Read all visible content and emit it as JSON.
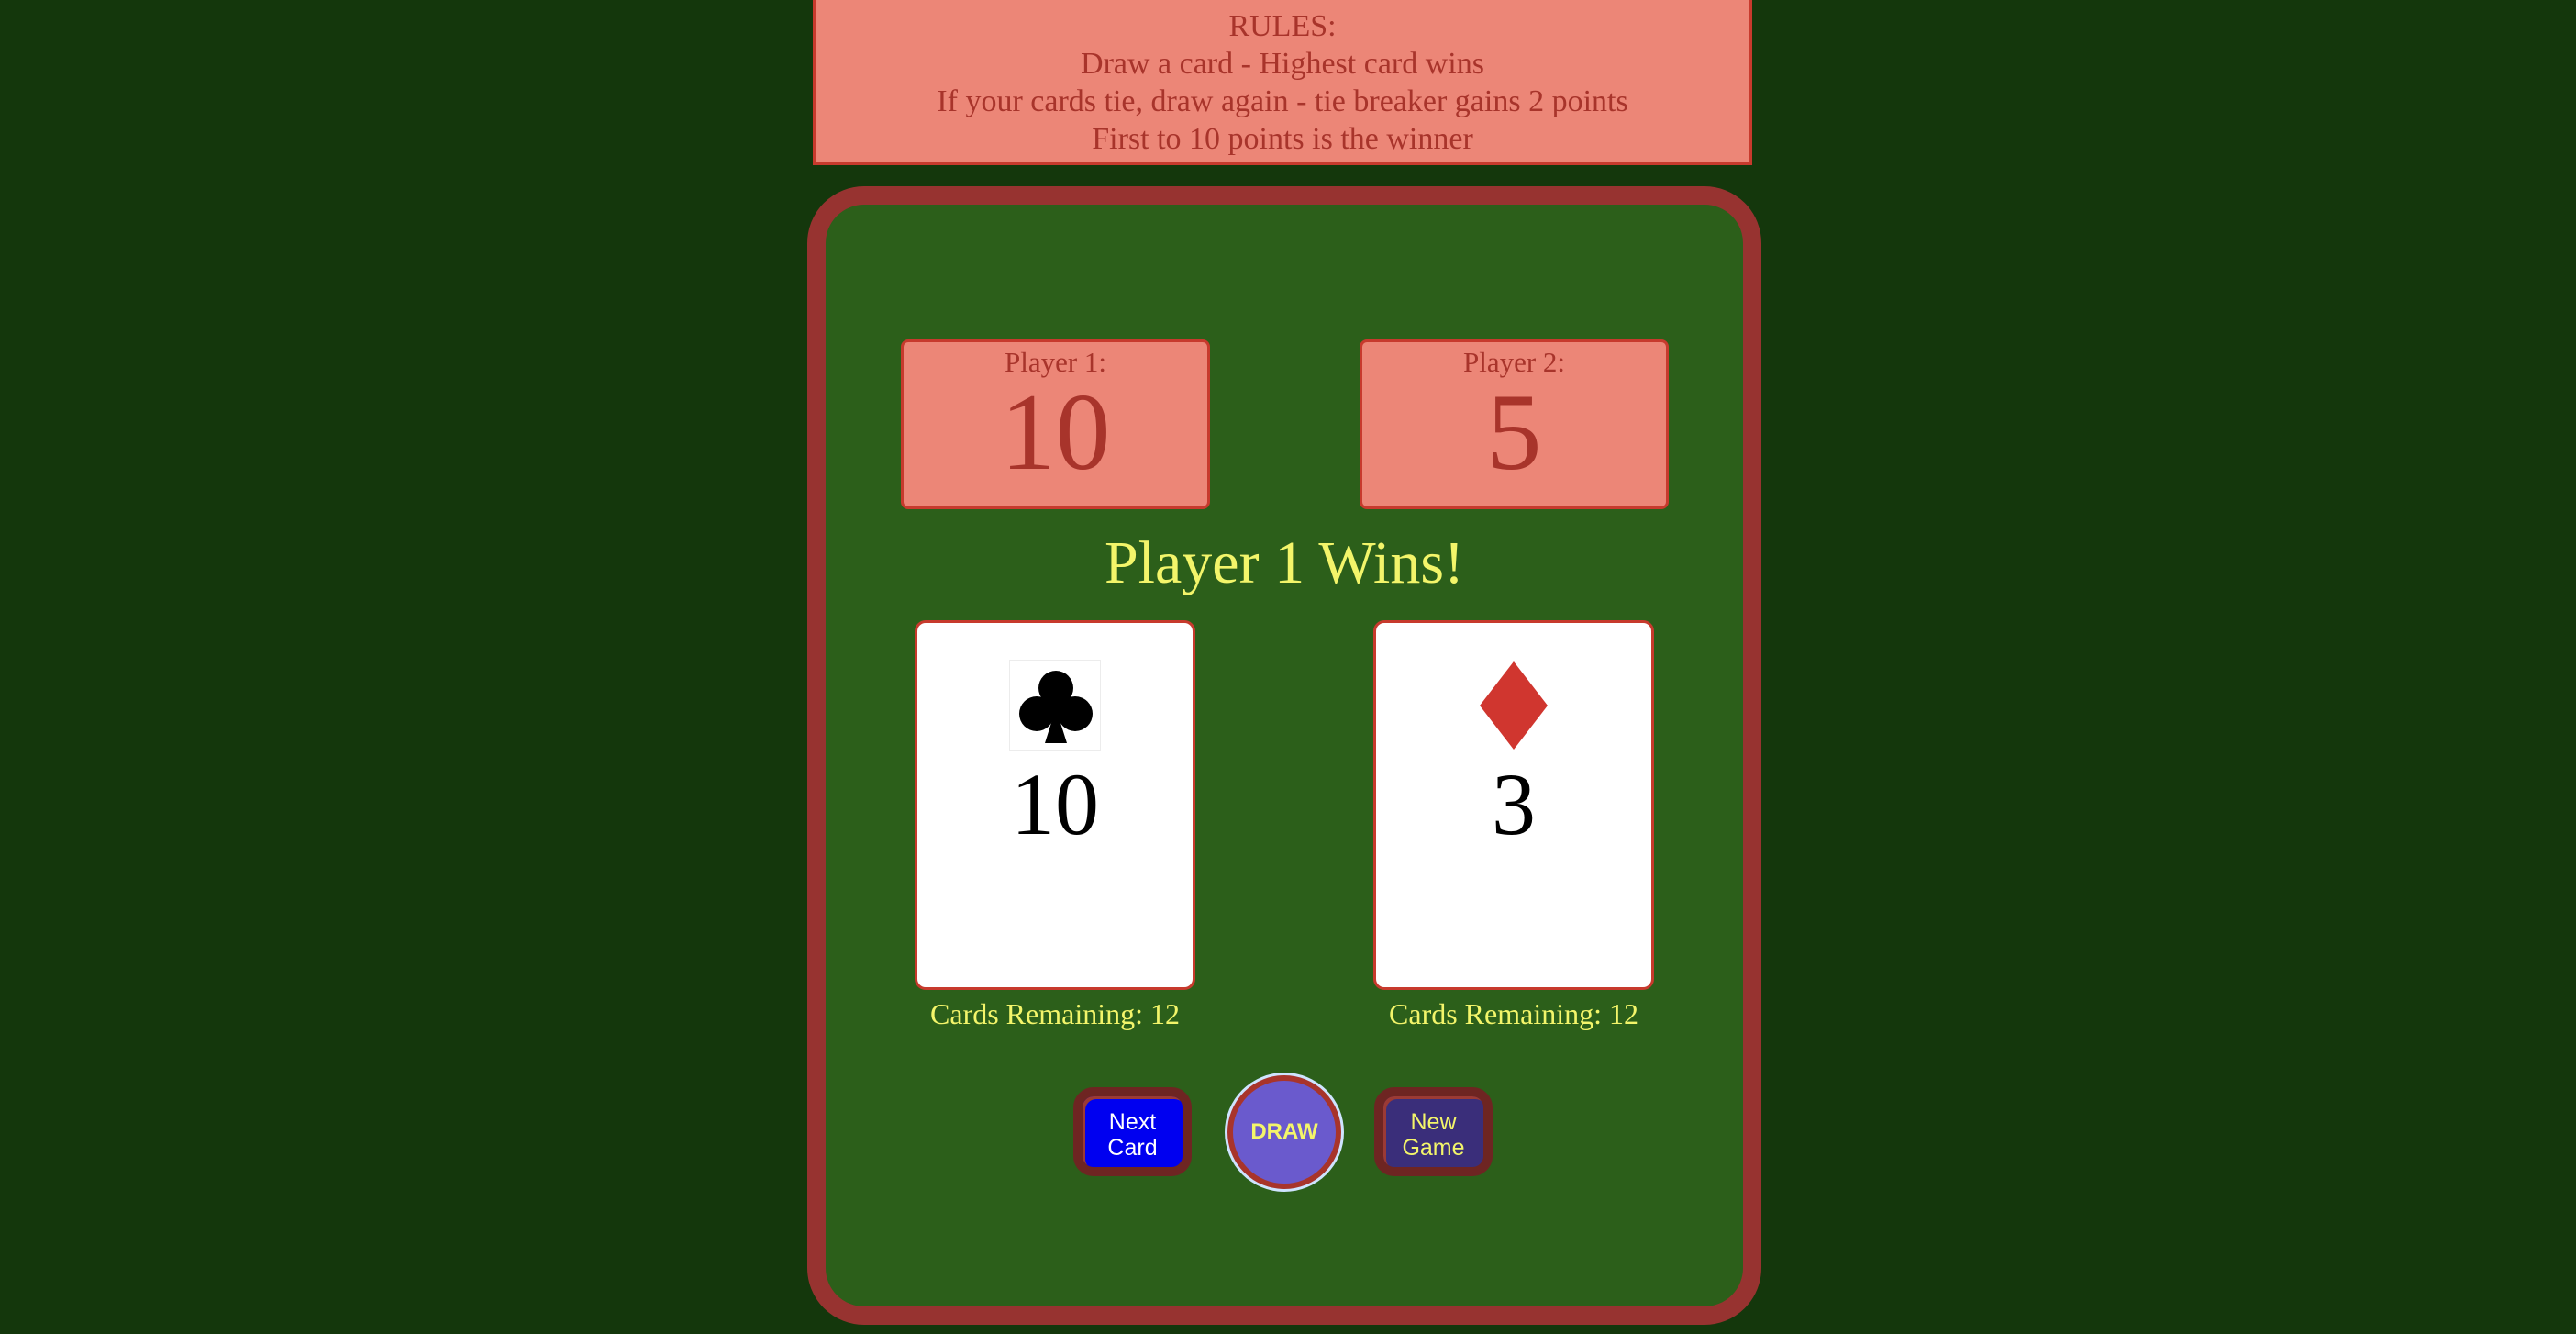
{
  "rules": {
    "heading": "RULES:",
    "line1": "Draw a card - Highest card wins",
    "line2": "If your cards tie, draw again - tie breaker gains 2 points",
    "line3": "First to 10 points is the winner"
  },
  "players": [
    {
      "label": "Player 1:",
      "score": "10",
      "card_rank": "10",
      "card_suit": "club-icon",
      "cards_remaining": "Cards Remaining: 12"
    },
    {
      "label": "Player 2:",
      "score": "5",
      "card_rank": "3",
      "card_suit": "diamond-icon",
      "cards_remaining": "Cards Remaining: 12"
    }
  ],
  "status": "Player 1 Wins!",
  "buttons": {
    "next_card_line1": "Next",
    "next_card_line2": "Card",
    "draw": "DRAW",
    "new_game_line1": "New",
    "new_game_line2": "Game"
  },
  "colors": {
    "table_background": "#14370c",
    "felt": "#2c5f1a",
    "rail": "#973330",
    "panel": "#ec8677",
    "panel_text": "#a8342b",
    "highlight_text": "#f3f56a",
    "diamond": "#d0362f",
    "club": "#000000"
  }
}
